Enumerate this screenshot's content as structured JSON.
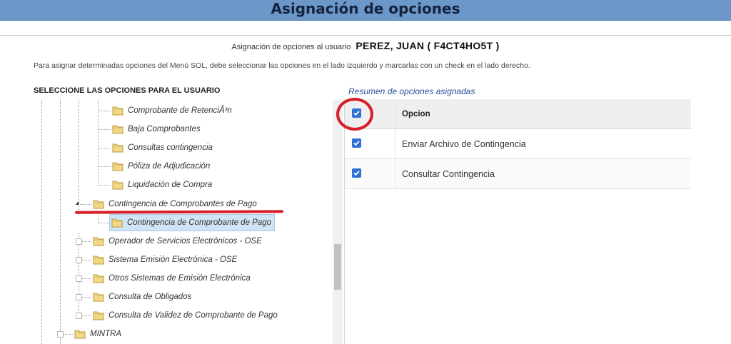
{
  "header": {
    "title": "Asignación de opciones"
  },
  "assignment": {
    "prefix": "Asignación de opciones al usuario",
    "user": "PEREZ, JUAN ( F4CT4HO5T )"
  },
  "instructions": "Para asignar determinadas opciones del Menú SOL, debe seleccionar las opciones en el lado izquierdo y marcarlas con un check en el lado derecho.",
  "tree": {
    "heading": "SELECCIONE LAS OPCIONES PARA EL USUARIO",
    "nodes": [
      "Comprobante de RetenciÃ³n",
      "Baja Comprobantes",
      "Consultas contingencia",
      "Póliza de Adjudicación",
      "Liquidación de Compra",
      "Contingencia de Comprobantes de Pago",
      "Contingencia de Comprobante de Pago",
      "Operador de Servicios Electrónicos - OSE",
      "Sistema Emisión Electrónica - OSE",
      "Otros Sistemas de Emisión Electrónica",
      "Consulta de Obligados",
      "Consulta de Validez de Comprobante de Pago",
      "MINTRA"
    ]
  },
  "summary": {
    "title": "Resumen de opciones asignadas",
    "column_header": "Opcion",
    "rows": [
      {
        "label": "Enviar Archivo de Contingencia",
        "checked": true
      },
      {
        "label": "Consultar Contingencia",
        "checked": true
      }
    ]
  },
  "colors": {
    "header": "#6b97c9",
    "checkbox": "#2f6fd6",
    "annotation": "#d61f26",
    "selected": "#cfe4f5"
  }
}
